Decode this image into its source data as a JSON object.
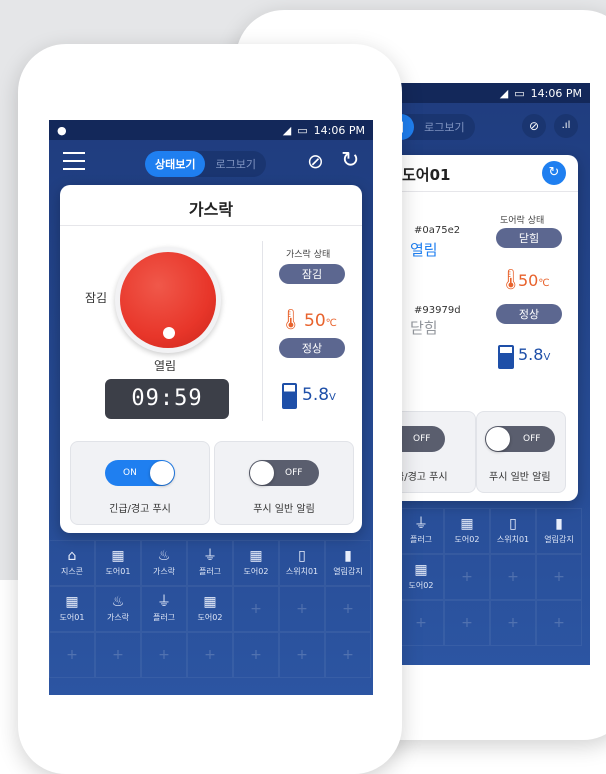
{
  "front": {
    "status": {
      "time": "14:06 PM"
    },
    "tabs": {
      "status_view": "상태보기",
      "log_view": "로그보기"
    },
    "card": {
      "title": "가스락",
      "locked_label": "잠김",
      "open_label": "열림",
      "timer": "09:59",
      "gaslock_state_label": "가스락 상태",
      "gaslock_state_value": "잠김",
      "temperature_value": "50",
      "temperature_unit": "℃",
      "temperature_status": "정상",
      "battery_value": "5.8",
      "battery_unit": "V",
      "toggles": [
        {
          "state": "ON",
          "label": "긴급/경고 푸시",
          "on": true
        },
        {
          "state": "OFF",
          "label": "푸시 일반 알림",
          "on": false
        }
      ]
    },
    "devices": [
      {
        "label": "지스콘",
        "icon": "router"
      },
      {
        "label": "도어01",
        "icon": "door"
      },
      {
        "label": "가스락",
        "icon": "flame"
      },
      {
        "label": "플러그",
        "icon": "plug"
      },
      {
        "label": "도어02",
        "icon": "door"
      },
      {
        "label": "스위치01",
        "icon": "switch"
      },
      {
        "label": "열림감지",
        "icon": "sensor"
      },
      {
        "label": "도어01",
        "icon": "door"
      },
      {
        "label": "가스락",
        "icon": "flame"
      },
      {
        "label": "플러그",
        "icon": "plug"
      },
      {
        "label": "도어02",
        "icon": "door"
      }
    ]
  },
  "back": {
    "status": {
      "time": "14:06 PM"
    },
    "tabs": {
      "status_view_fragment": "기",
      "log_view": "로그보기"
    },
    "card": {
      "title": "도어01",
      "color_code_1": "#0a75e2",
      "state_1": "열림",
      "color_code_2": "#93979d",
      "state_2": "닫힘",
      "door_state_label": "도어락 상태",
      "door_state_value": "닫힘",
      "temperature_value": "50",
      "temperature_unit": "℃",
      "temperature_status": "정상",
      "battery_value": "5.8",
      "battery_unit": "V",
      "toggles": [
        {
          "state": "OFF",
          "label": "급/경고 푸시"
        },
        {
          "state": "OFF",
          "label": "푸시 일반 알림"
        }
      ]
    },
    "devices": [
      {
        "label": "플러그",
        "icon": "plug"
      },
      {
        "label": "도어02",
        "icon": "door"
      },
      {
        "label": "스위치01",
        "icon": "switch"
      },
      {
        "label": "열림감지",
        "icon": "sensor"
      },
      {
        "label": "도어02",
        "icon": "door"
      }
    ]
  },
  "colors": {
    "accent": "#1f7ff0",
    "temp": "#e8622c",
    "battery": "#1e4fa8",
    "dial": "#e8362a"
  }
}
